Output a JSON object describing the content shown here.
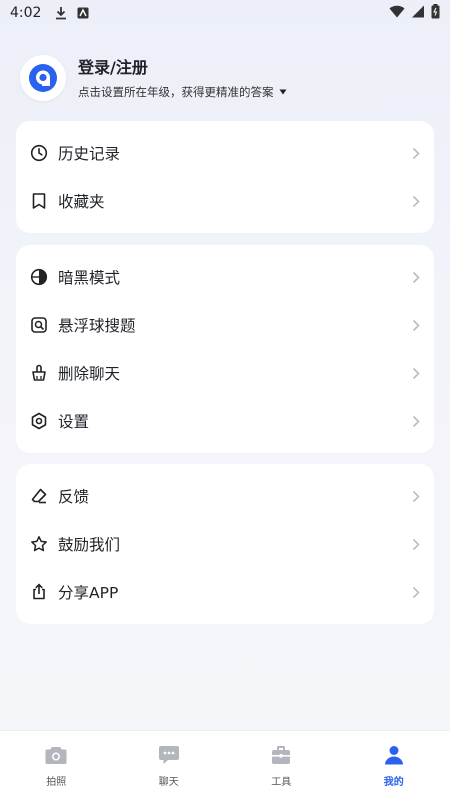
{
  "status_bar": {
    "time": "4:02"
  },
  "profile": {
    "title": "登录/注册",
    "subtitle": "点击设置所在年级，获得更精准的答案"
  },
  "menu_groups": [
    {
      "items": [
        {
          "label": "历史记录",
          "icon": "clock-icon"
        },
        {
          "label": "收藏夹",
          "icon": "bookmark-icon"
        }
      ]
    },
    {
      "items": [
        {
          "label": "暗黑模式",
          "icon": "dark-mode-icon"
        },
        {
          "label": "悬浮球搜题",
          "icon": "floating-search-icon"
        },
        {
          "label": "删除聊天",
          "icon": "broom-icon"
        },
        {
          "label": "设置",
          "icon": "gear-icon"
        }
      ]
    },
    {
      "items": [
        {
          "label": "反馈",
          "icon": "eraser-icon"
        },
        {
          "label": "鼓励我们",
          "icon": "star-icon"
        },
        {
          "label": "分享APP",
          "icon": "share-icon"
        }
      ]
    }
  ],
  "tabs": [
    {
      "label": "拍照",
      "icon": "camera-icon",
      "active": false
    },
    {
      "label": "聊天",
      "icon": "chat-icon",
      "active": false
    },
    {
      "label": "工具",
      "icon": "toolbox-icon",
      "active": false
    },
    {
      "label": "我的",
      "icon": "user-icon",
      "active": true
    }
  ],
  "colors": {
    "accent": "#2a62f0",
    "inactive_tab": "#b3b6bd",
    "background": "#f3f4fa"
  }
}
